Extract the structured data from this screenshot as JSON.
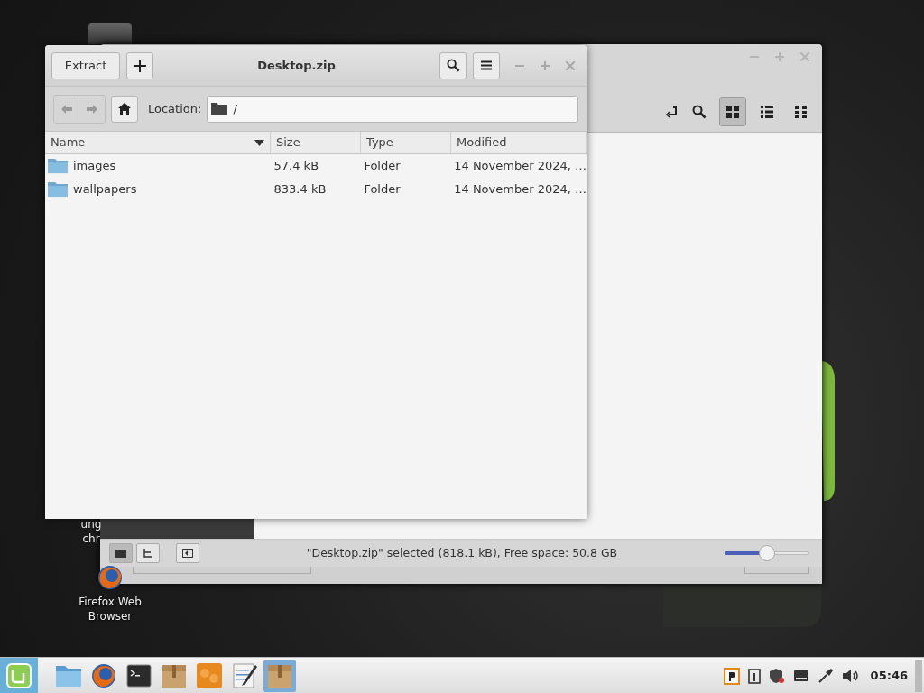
{
  "desktop_icons": [
    {
      "kind": "partial",
      "lines": [
        "ung",
        "chr"
      ]
    },
    {
      "kind": "firefox",
      "lines": [
        "Firefox Web",
        "Browser"
      ]
    }
  ],
  "back_window": {
    "view_modes": [
      {
        "kind": "icons",
        "selected": true
      },
      {
        "kind": "list",
        "selected": false
      },
      {
        "kind": "compact",
        "selected": false
      }
    ],
    "sidebar_modes": [
      {
        "kind": "places",
        "selected": true
      },
      {
        "kind": "tree",
        "selected": false
      }
    ],
    "status": "\"Desktop.zip\" selected (818.1 kB), Free space: 50.8 GB",
    "zoom": {
      "level": 0.5
    }
  },
  "archive_window": {
    "title": "Desktop.zip",
    "extract_button": "Extract",
    "location_label": "Location:",
    "path": "/",
    "columns": [
      {
        "label": "Name",
        "sorted": true
      },
      {
        "label": "Size",
        "sorted": false
      },
      {
        "label": "Type",
        "sorted": false
      },
      {
        "label": "Modified",
        "sorted": false
      }
    ],
    "rows": [
      {
        "name": "images",
        "size": "57.4 kB",
        "type": "Folder",
        "modified": "14 November 2024, …"
      },
      {
        "name": "wallpapers",
        "size": "833.4 kB",
        "type": "Folder",
        "modified": "14 November 2024, …"
      }
    ]
  },
  "taskbar": {
    "apps": [
      {
        "kind": "files",
        "selected": false
      },
      {
        "kind": "firefox",
        "selected": false
      },
      {
        "kind": "terminal",
        "selected": false
      },
      {
        "kind": "archive",
        "selected": false
      },
      {
        "kind": "orange",
        "selected": false
      },
      {
        "kind": "editor",
        "selected": false
      },
      {
        "kind": "archive",
        "selected": true
      }
    ],
    "tray": [
      {
        "kind": "p"
      },
      {
        "kind": "clipboard"
      },
      {
        "kind": "shield"
      },
      {
        "kind": "keyboard"
      },
      {
        "kind": "network"
      },
      {
        "kind": "volume"
      }
    ],
    "clock": "05:46"
  }
}
